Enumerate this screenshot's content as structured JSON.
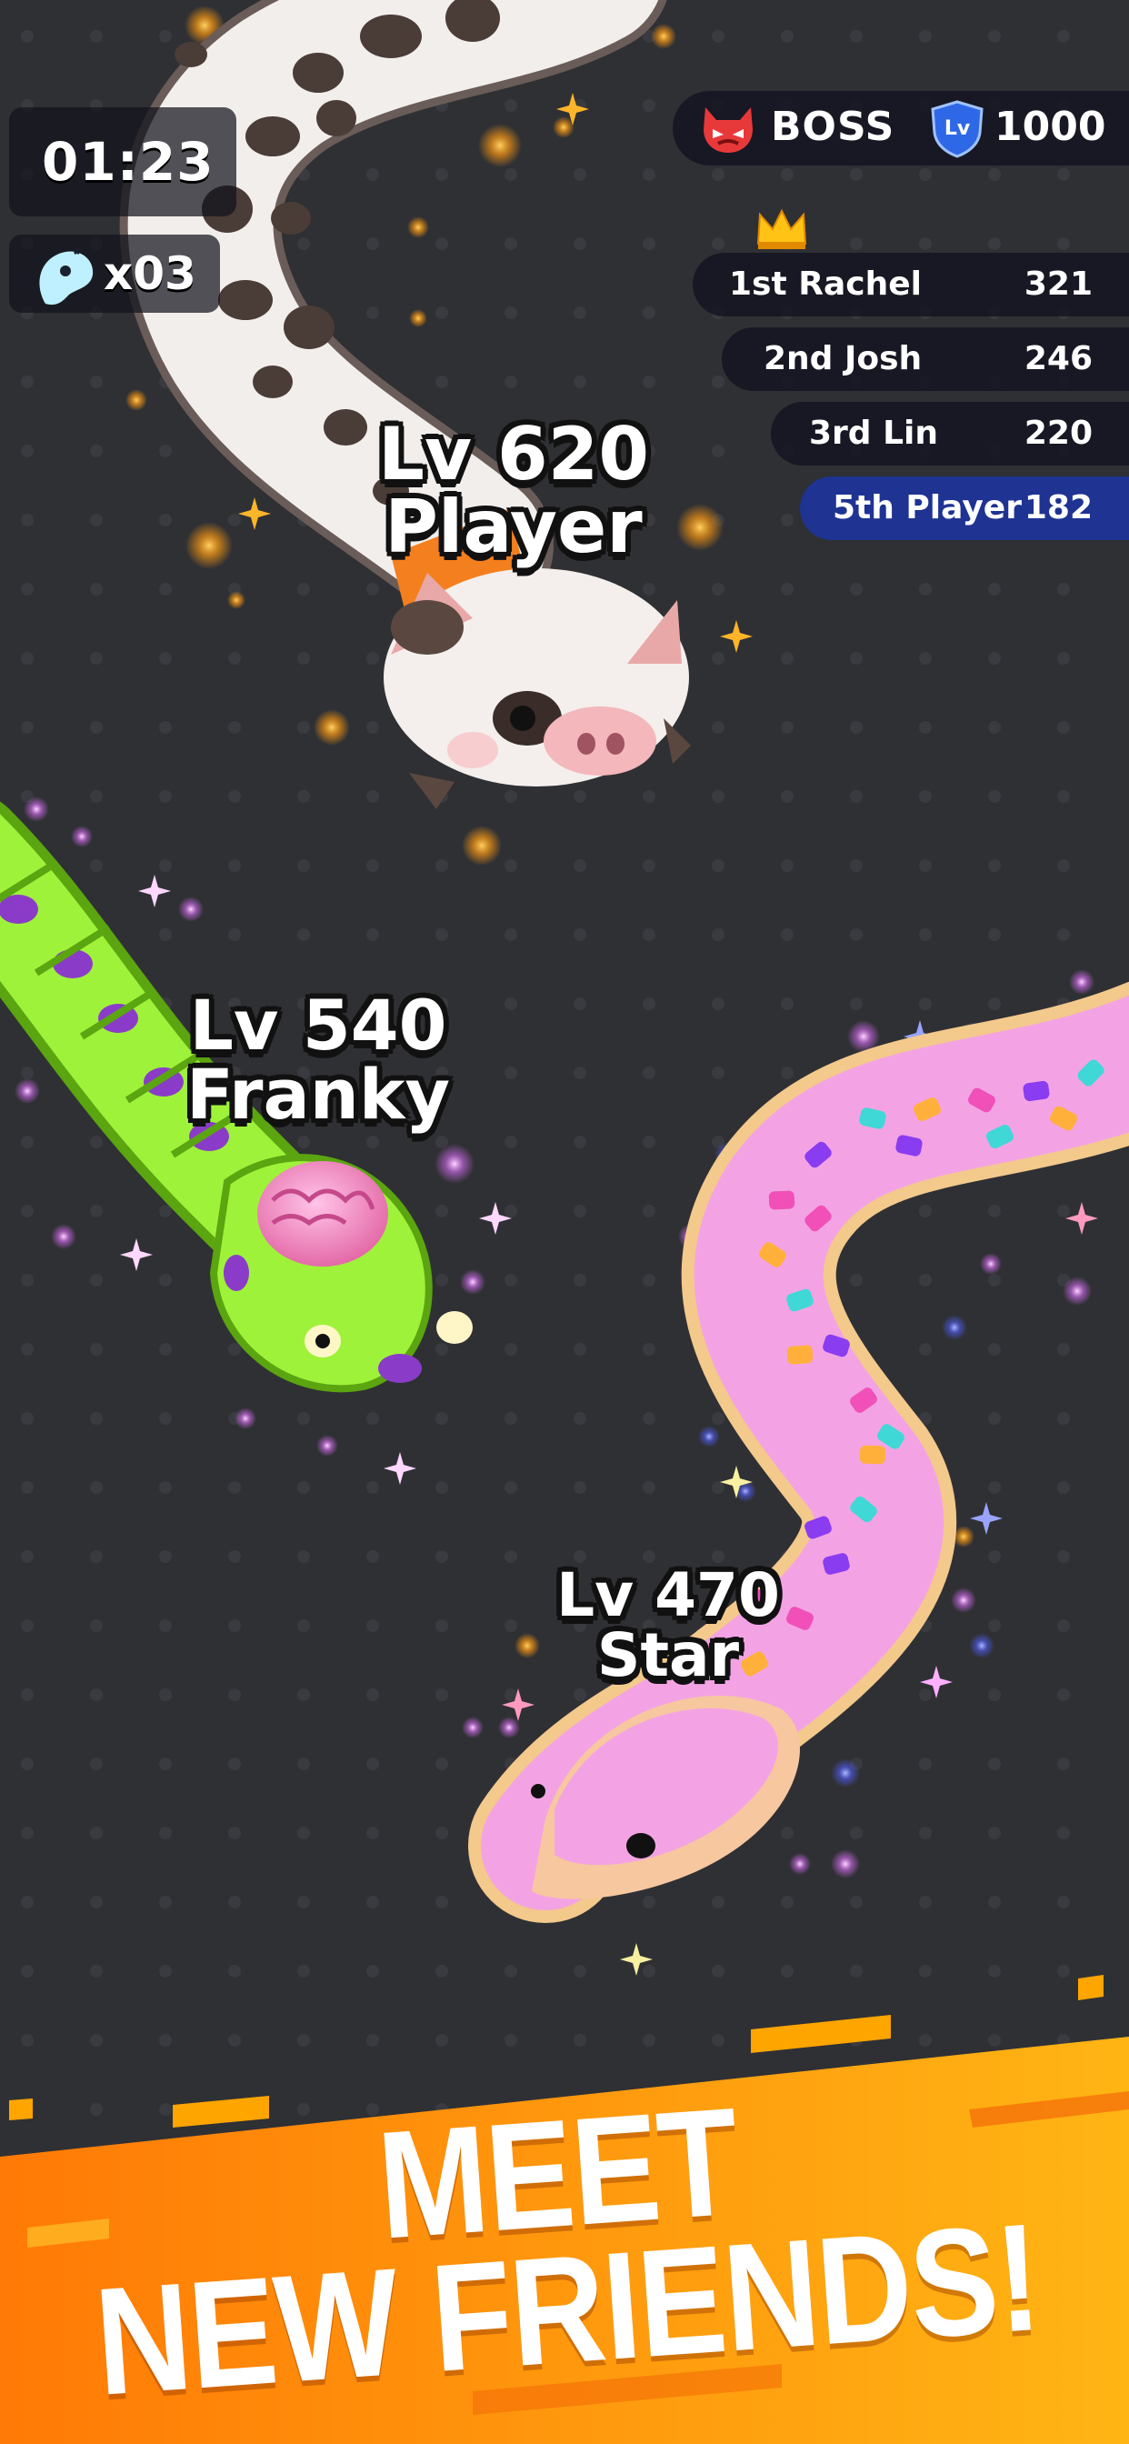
{
  "hud": {
    "timer": "01:23",
    "powerup_count": "x03",
    "powerup_icon": "ghost-snake-icon"
  },
  "boss": {
    "label": "BOSS",
    "icon": "devil-mask-icon",
    "level_badge": "Lv",
    "level": "1000"
  },
  "leaderboard": {
    "crown_icon": "crown-icon",
    "rows": [
      {
        "name": "1st Rachel",
        "score": "321"
      },
      {
        "name": "2nd Josh",
        "score": "246"
      },
      {
        "name": "3rd Lin",
        "score": "220"
      },
      {
        "name": "5th Player",
        "score": "182"
      }
    ]
  },
  "snakes": [
    {
      "level": "Lv 620",
      "name": "Player",
      "skin": "cow-pig"
    },
    {
      "level": "Lv 540",
      "name": "Franky",
      "skin": "green-zombie-brain"
    },
    {
      "level": "Lv 470",
      "name": "Star",
      "skin": "pink-sprinkle-donut"
    }
  ],
  "banner": {
    "line1": "MEET",
    "line2": "NEW FRIENDS!"
  },
  "colors": {
    "background": "#2f3034",
    "banner_orange": "#ff9a10",
    "player_row": "#1e3392",
    "franky_green": "#8fe12a",
    "star_pink": "#f09ce0"
  }
}
